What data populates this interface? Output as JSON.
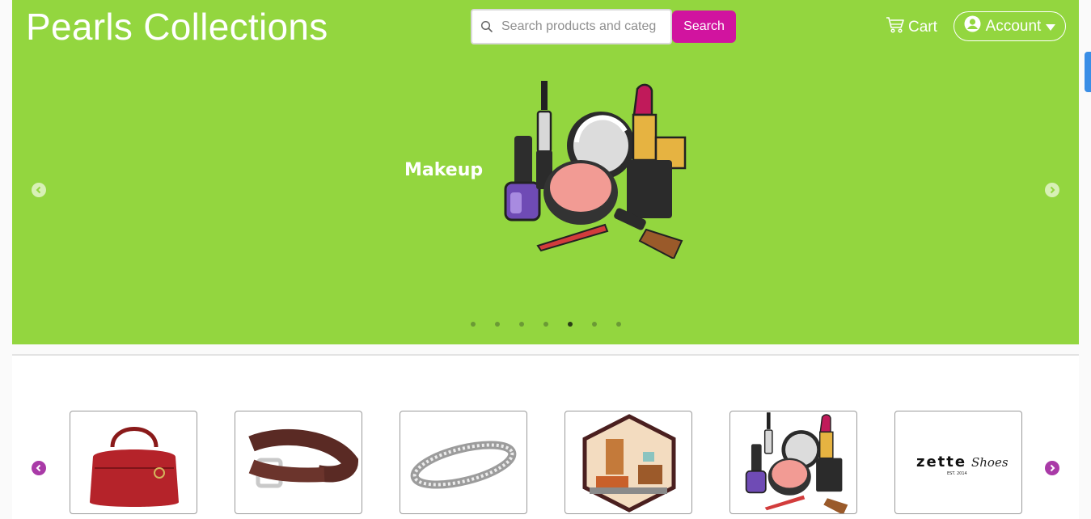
{
  "header": {
    "brand": "Pearls Collections",
    "search": {
      "placeholder": "Search products and categ",
      "button_label": "Search"
    },
    "cart_label": "Cart",
    "account_label": "Account"
  },
  "hero": {
    "slide_label": "Makeup",
    "slide_count": 7,
    "active_slide": 5
  },
  "categories": [
    {
      "icon": "handbag-icon"
    },
    {
      "icon": "belt-icon"
    },
    {
      "icon": "bracelet-icon"
    },
    {
      "icon": "furniture-icon"
    },
    {
      "icon": "makeup-icon"
    },
    {
      "icon": "zette-shoes-logo",
      "logo_text": "zette",
      "logo_script": "Shoes",
      "logo_est": "EST. 2014"
    }
  ],
  "colors": {
    "hero_bg": "#93d63f",
    "search_button": "#d1149f",
    "carousel_arrow": "#a93aa7"
  }
}
